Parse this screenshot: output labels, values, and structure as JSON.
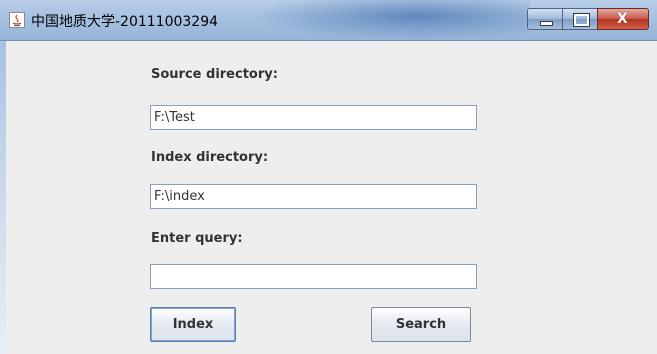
{
  "window": {
    "title": "中国地质大学-20111003294",
    "controls": {
      "minimize": "–",
      "maximize": "□",
      "close": "X"
    }
  },
  "form": {
    "source_label": "Source directory:",
    "source_value": "F:\\Test",
    "index_label": "Index directory:",
    "index_value": "F:\\index",
    "query_label": "Enter query:",
    "query_value": ""
  },
  "buttons": {
    "index_label": "Index",
    "search_label": "Search"
  },
  "colors": {
    "titlebar": "#a6c1e1",
    "window_bg": "#eeeeee",
    "close_button": "#c9584a"
  }
}
